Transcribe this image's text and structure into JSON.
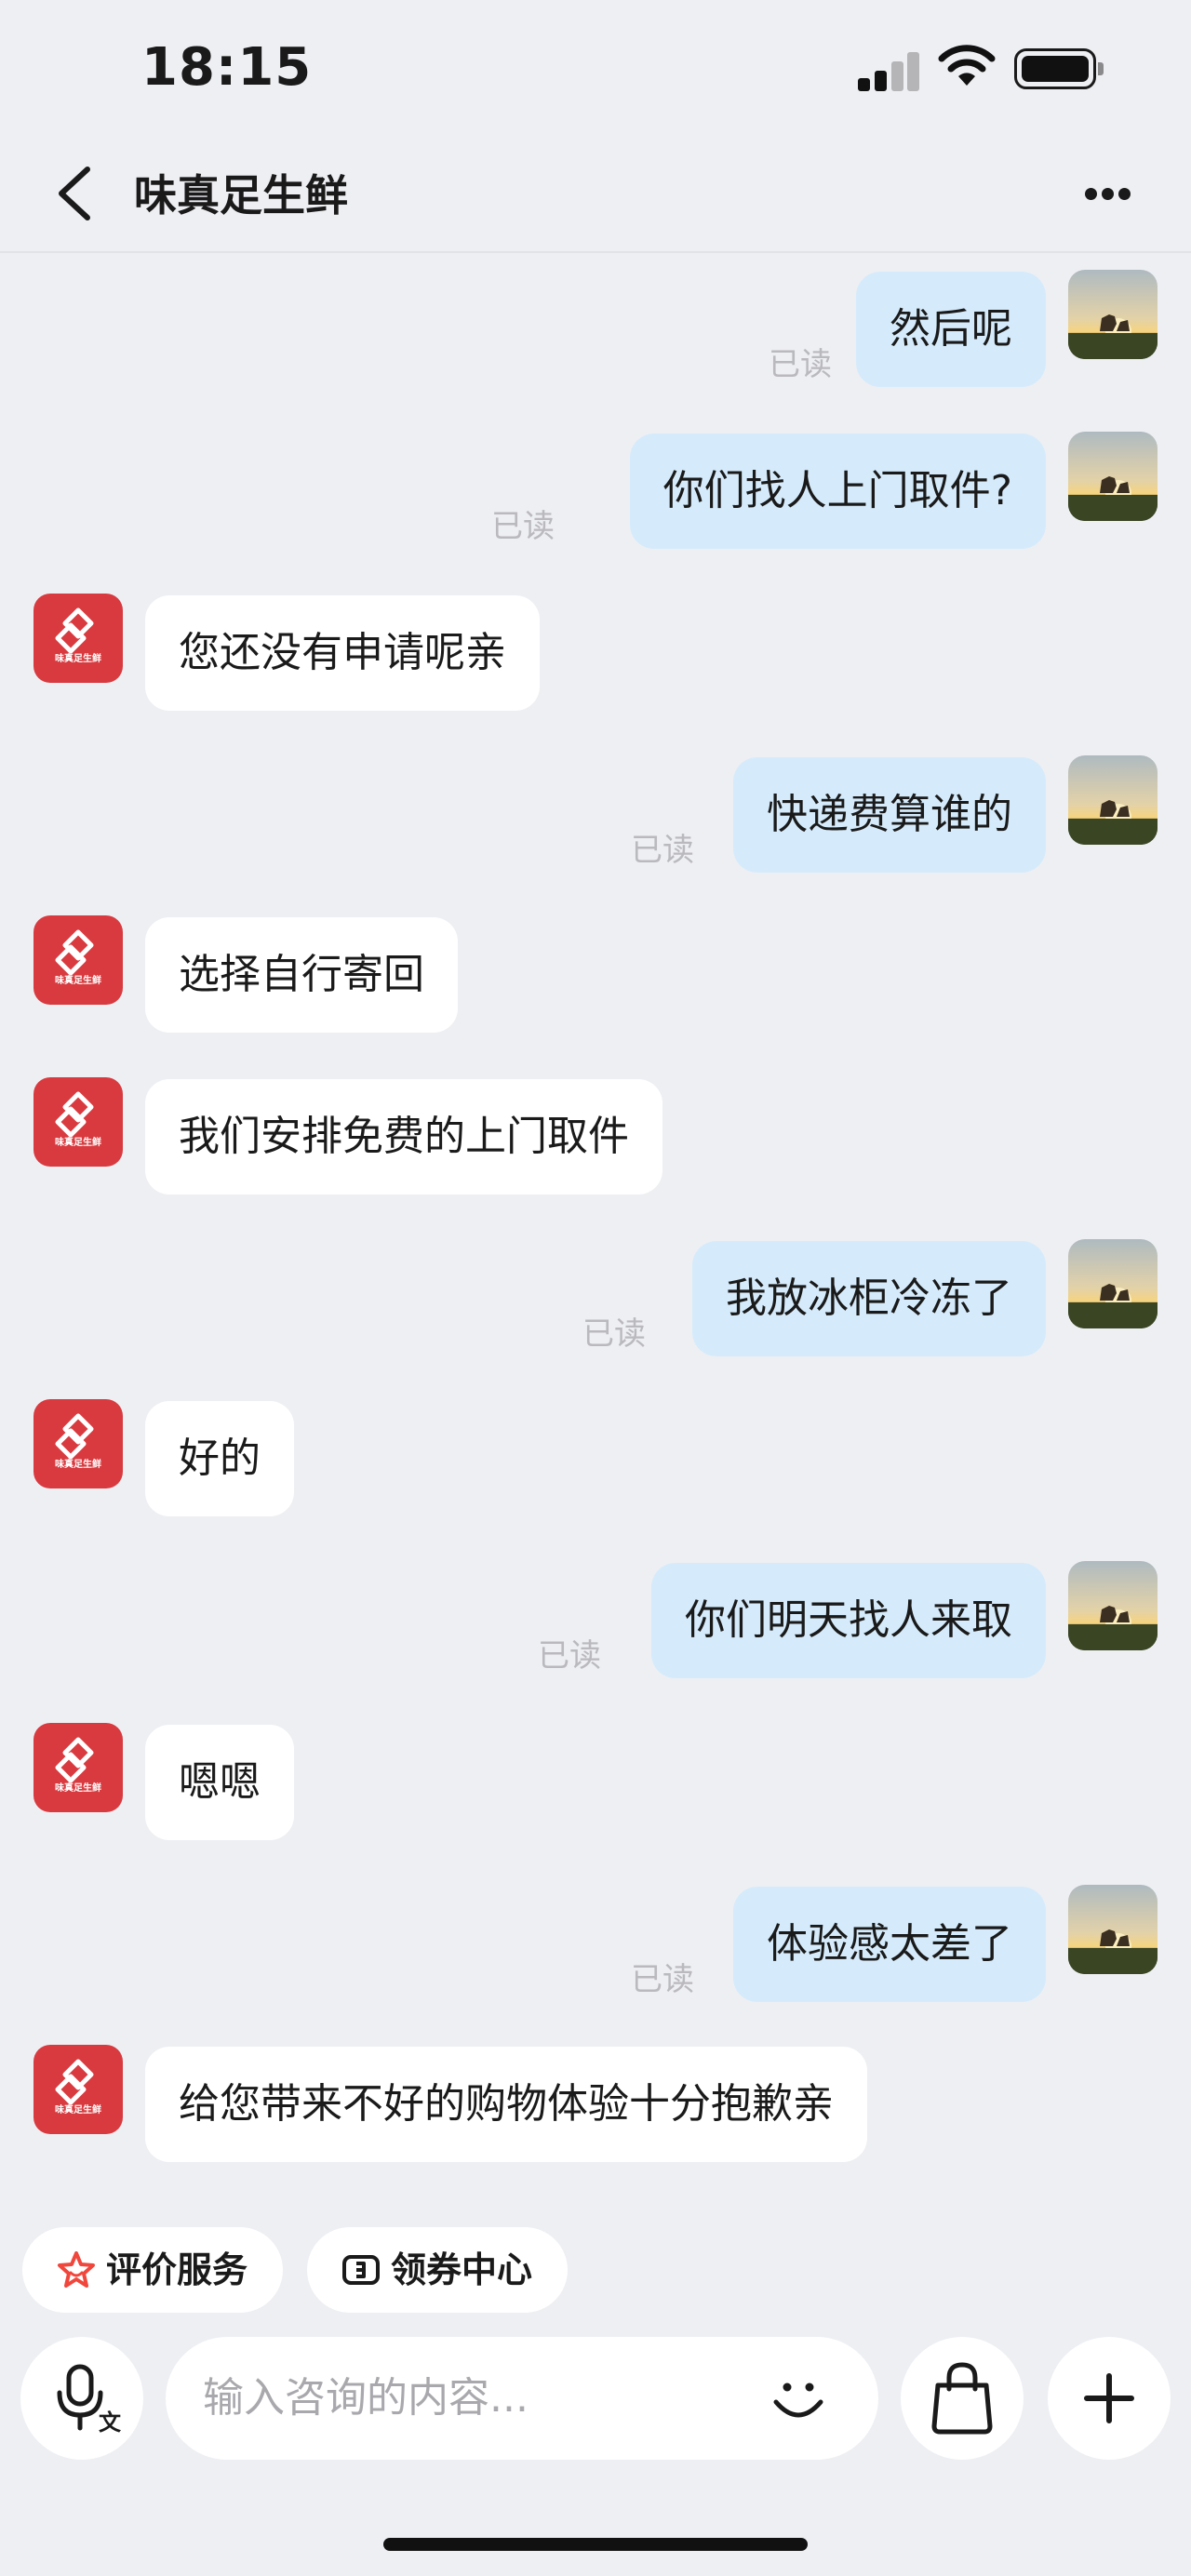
{
  "status_bar": {
    "time": "18:15",
    "icons": [
      "signal-icon",
      "wifi-icon",
      "battery-icon"
    ]
  },
  "nav": {
    "title": "味真足生鲜",
    "back_icon": "chevron-left-icon",
    "more_icon": "more-dots-icon"
  },
  "shop": {
    "logo_text": "味真足生鲜",
    "brand_color": "#d83a3f"
  },
  "colors": {
    "my_bubble": "#d5ebfb",
    "shop_bubble": "#ffffff",
    "background": "#eeeff3",
    "read_status": "#b9b9be"
  },
  "messages": [
    {
      "sender": "me",
      "text": "然后呢",
      "status": "已读"
    },
    {
      "sender": "me",
      "text": "你们找人上门取件?",
      "status": "已读"
    },
    {
      "sender": "shop",
      "text": "您还没有申请呢亲"
    },
    {
      "sender": "me",
      "text": "快递费算谁的",
      "status": "已读"
    },
    {
      "sender": "shop",
      "text": "选择自行寄回"
    },
    {
      "sender": "shop",
      "text": "我们安排免费的上门取件"
    },
    {
      "sender": "me",
      "text": "我放冰柜冷冻了",
      "status": "已读"
    },
    {
      "sender": "shop",
      "text": "好的"
    },
    {
      "sender": "me",
      "text": "你们明天找人来取",
      "status": "已读"
    },
    {
      "sender": "shop",
      "text": "嗯嗯"
    },
    {
      "sender": "me",
      "text": "体验感太差了",
      "status": "已读"
    },
    {
      "sender": "shop",
      "text": "给您带来不好的购物体验十分抱歉亲"
    }
  ],
  "quick_actions": [
    {
      "label": "评价服务",
      "icon": "star-icon"
    },
    {
      "label": "领券中心",
      "icon": "coupon-icon"
    }
  ],
  "input": {
    "placeholder": "输入咨询的内容...",
    "voice_icon": "voice-translate-icon",
    "emoji_icon": "smile-icon",
    "bag_icon": "shopping-bag-icon",
    "add_icon": "plus-icon"
  }
}
